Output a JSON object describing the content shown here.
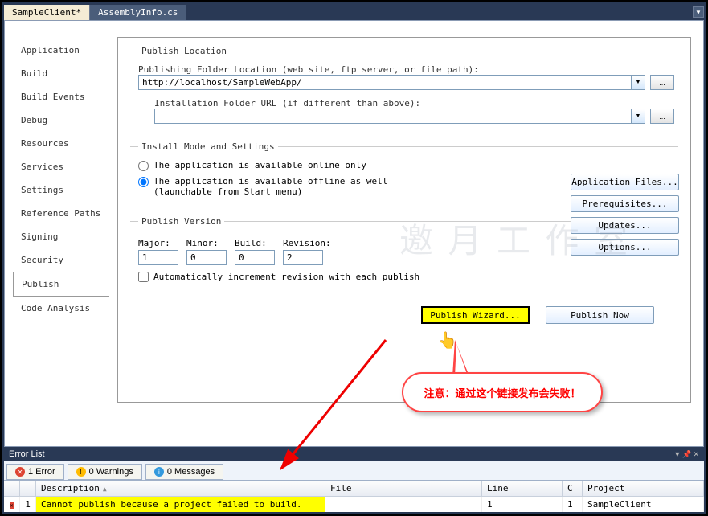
{
  "tabs": {
    "active": "SampleClient*",
    "other": "AssemblyInfo.cs"
  },
  "sideTabs": [
    "Application",
    "Build",
    "Build Events",
    "Debug",
    "Resources",
    "Services",
    "Settings",
    "Reference Paths",
    "Signing",
    "Security",
    "Publish",
    "Code Analysis"
  ],
  "activeSideTab": "Publish",
  "publishLocation": {
    "legend": "Publish Location",
    "label": "Publishing Folder Location (web site, ftp server, or file path):",
    "value": "http://localhost/SampleWebApp/",
    "installLabel": "Installation Folder URL (if different than above):",
    "installValue": ""
  },
  "installMode": {
    "legend": "Install Mode and Settings",
    "onlineOnly": "The application is available online only",
    "offline": "The application is available offline as well (launchable from Start menu)",
    "buttons": {
      "files": "Application Files...",
      "prereq": "Prerequisites...",
      "updates": "Updates...",
      "options": "Options..."
    }
  },
  "version": {
    "legend": "Publish Version",
    "major": {
      "label": "Major:",
      "value": "1"
    },
    "minor": {
      "label": "Minor:",
      "value": "0"
    },
    "build": {
      "label": "Build:",
      "value": "0"
    },
    "revision": {
      "label": "Revision:",
      "value": "2"
    },
    "autoIncrement": "Automatically increment revision with each publish"
  },
  "actions": {
    "wizard": "Publish Wizard...",
    "now": "Publish Now"
  },
  "callout": "注意：通过这个链接发布会失败！",
  "watermark": "邀 月 工 作 室",
  "errorPanel": {
    "title": "Error List",
    "tabs": {
      "errors": "1 Error",
      "warnings": "0 Warnings",
      "messages": "0 Messages"
    },
    "columns": {
      "desc": "Description",
      "file": "File",
      "line": "Line",
      "c": "C",
      "proj": "Project"
    },
    "row": {
      "num": "1",
      "desc": "Cannot publish because a project failed to build.",
      "file": "",
      "line": "1",
      "c": "1",
      "proj": "SampleClient"
    }
  }
}
